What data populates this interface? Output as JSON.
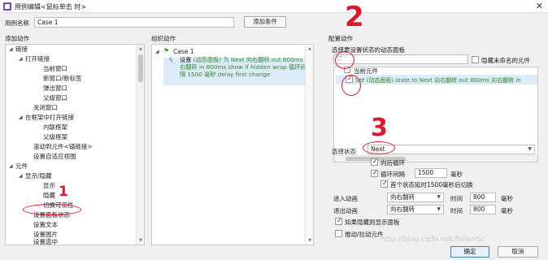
{
  "window": {
    "title": "用例编辑<鼠标单击 时>",
    "close_glyph": "✕"
  },
  "case_name": {
    "label": "用例名称",
    "value": "Case 1"
  },
  "add_condition_label": "添加条件",
  "sections": {
    "add_action": "添加动作",
    "organize_action": "组织动作",
    "configure_action": "配置动作"
  },
  "add_action_tree": [
    {
      "label": "链接",
      "expanded": true
    },
    {
      "label": "打开链接",
      "expanded": true
    },
    {
      "label": "当前窗口"
    },
    {
      "label": "新窗口/新标签"
    },
    {
      "label": "弹出窗口"
    },
    {
      "label": "父级窗口"
    },
    {
      "label": "关闭窗口"
    },
    {
      "label": "在框架中打开链接",
      "expanded": true
    },
    {
      "label": "内联框架"
    },
    {
      "label": "父级框架"
    },
    {
      "label": "滚动到元件<锚链接>"
    },
    {
      "label": "设置自适应视图"
    },
    {
      "label": "元件",
      "expanded": true
    },
    {
      "label": "显示/隐藏",
      "expanded": true
    },
    {
      "label": "显示"
    },
    {
      "label": "隐藏"
    },
    {
      "label": "切换可见性"
    },
    {
      "label": "设置面板状态"
    },
    {
      "label": "设置文本"
    },
    {
      "label": "设置图片"
    },
    {
      "label": "设置选中"
    }
  ],
  "organize": {
    "case_label": "Case 1",
    "action_prefix": "设置 ",
    "action_body": "(动态面板) 为 Next 向右翻转 out 800ms 向右翻转 in 800ms show if hidden wrap 循环间隔 1500 毫秒 delay first change"
  },
  "config": {
    "select_panel_label": "选择要设置状态的动态面板",
    "hide_unnamed_label": "隐藏未命名的元件",
    "current_element_label": "当前元件",
    "set_row_text": "Set (动态面板) state to Next 向右翻转 out 800ms 向右翻转 in",
    "select_state_label": "选择状态",
    "state_value": "Next",
    "wrap_label": "向后循环",
    "repeat_label": "循环间隔",
    "repeat_value": "1500",
    "ms_unit": "毫秒",
    "first_delay_label": "首个状态延时1500毫秒后切换",
    "enter_anim_label": "进入动画",
    "exit_anim_label": "退出动画",
    "enter_anim_value": "向右翻转",
    "exit_anim_value": "向右翻转",
    "time_label": "时间",
    "enter_time": "800",
    "exit_time": "800",
    "show_if_hidden_label": "如果隐藏则显示面板",
    "push_pull_label": "推动/拉动元件"
  },
  "buttons": {
    "ok": "确定",
    "cancel": "取消"
  },
  "annotations": {
    "n1": "1",
    "n2": "2",
    "n3": "3"
  },
  "watermark": "http://blog.csdn.net/FallenSc",
  "colors": {
    "annotation_red": "#e0182d",
    "selection_blue": "#dcebf7",
    "action_green": "#2e8b2e"
  }
}
